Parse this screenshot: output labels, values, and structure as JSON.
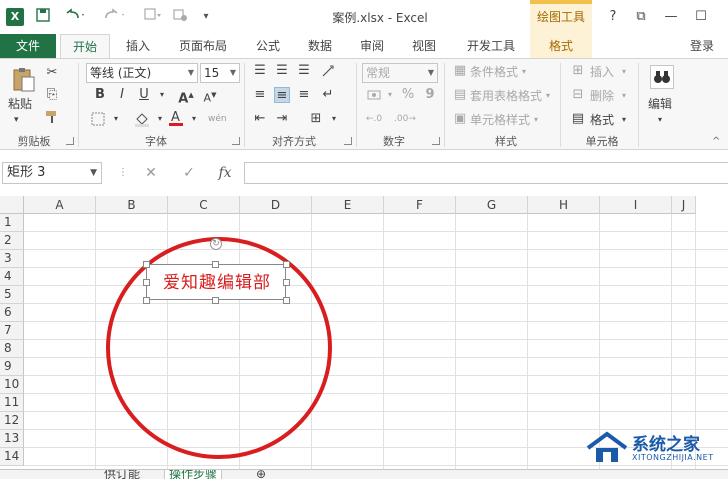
{
  "titlebar": {
    "logo": "X",
    "title": "案例.xlsx - Excel",
    "contextual_group": "绘图工具",
    "help": "?",
    "restore_icon": "⧉",
    "minimize": "—",
    "maximize": "☐"
  },
  "tabs": {
    "file": "文件",
    "items": [
      "开始",
      "插入",
      "页面布局",
      "公式",
      "数据",
      "审阅",
      "视图",
      "开发工具"
    ],
    "contextual": "格式",
    "login": "登录"
  },
  "ribbon": {
    "clipboard": {
      "paste": "粘贴",
      "label": "剪贴板"
    },
    "font": {
      "name": "等线 (正文)",
      "size": "15",
      "label": "字体",
      "bold": "B",
      "italic": "I",
      "underline": "U"
    },
    "alignment": {
      "label": "对齐方式"
    },
    "number": {
      "format": "常规",
      "percent": "%",
      "comma": "9",
      "label": "数字"
    },
    "styles": {
      "conditional": "条件格式",
      "table": "套用表格格式",
      "cell": "单元格样式",
      "label": "样式"
    },
    "cells": {
      "insert": "插入",
      "delete": "删除",
      "format": "格式",
      "label": "单元格"
    },
    "editing": {
      "label": "编辑"
    }
  },
  "formula_bar": {
    "name_box": "矩形 3",
    "fx": "fx",
    "cancel": "✕",
    "enter": "✓"
  },
  "grid": {
    "columns": [
      "A",
      "B",
      "C",
      "D",
      "E",
      "F",
      "G",
      "H",
      "I",
      "J"
    ],
    "rows": [
      "1",
      "2",
      "3",
      "4",
      "5",
      "6",
      "7",
      "8",
      "9",
      "10",
      "11",
      "12",
      "13",
      "14"
    ]
  },
  "shapes": {
    "textbox_text": "爱知趣编辑部",
    "circle_color": "#d81e1e",
    "text_color": "#d81e1e"
  },
  "sheets": [
    "供订能",
    "操作步骤"
  ],
  "watermark": {
    "title": "系统之家",
    "subtitle": "XITONGZHIJIA.NET"
  },
  "colors": {
    "excel_green": "#217346",
    "contextual_tab_bg": "#fdf1d6"
  }
}
